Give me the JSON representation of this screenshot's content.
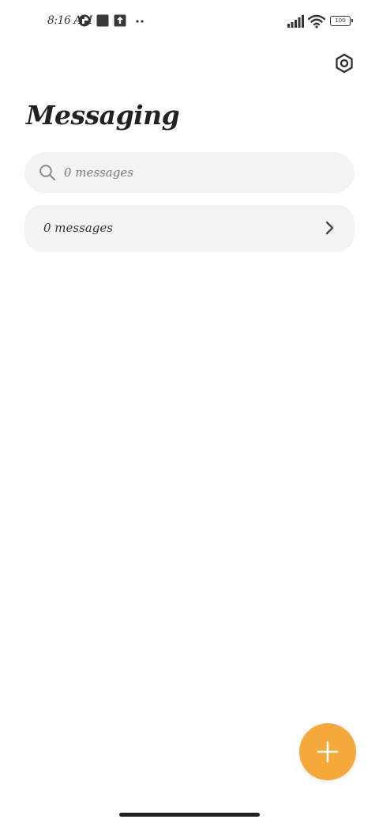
{
  "status_bar": {
    "time": "8:16 AM",
    "battery": "100"
  },
  "header": {
    "title": "Messaging",
    "settings_icon": "settings-hexagon-icon"
  },
  "search": {
    "placeholder": "0 messages",
    "value": ""
  },
  "conversations": {
    "row_label": "0 messages"
  },
  "fab": {
    "icon": "plus-icon"
  },
  "colors": {
    "accent": "#f6a93b",
    "surface": "#f3f3f3",
    "text": "#222222"
  }
}
